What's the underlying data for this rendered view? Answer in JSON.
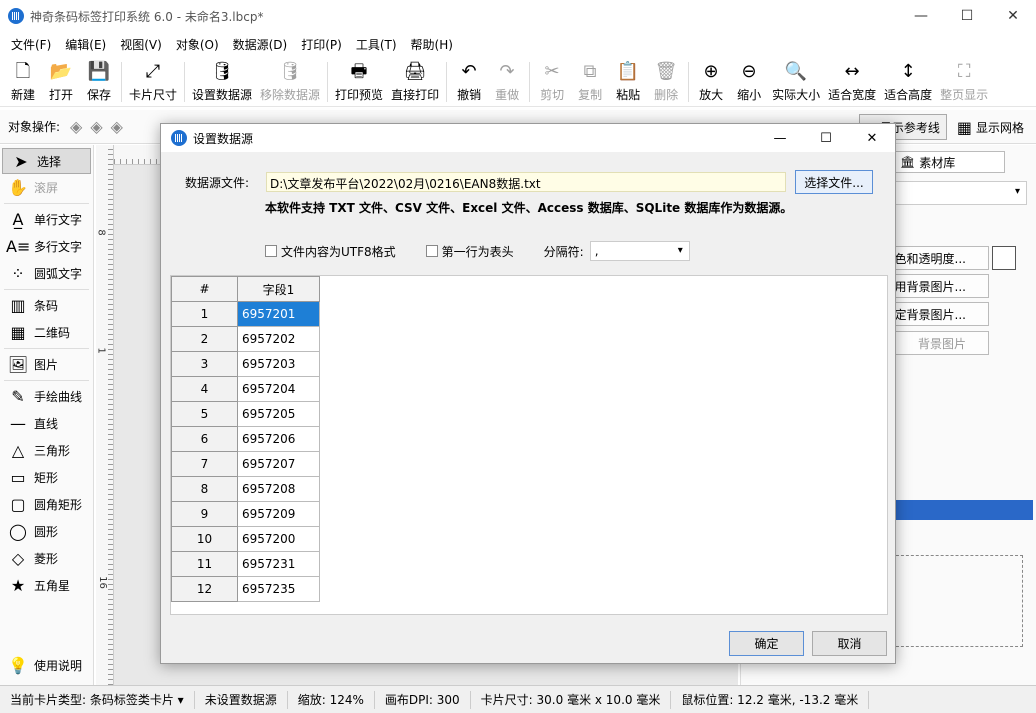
{
  "window": {
    "title": "神奇条码标签打印系统 6.0 - 未命名3.lbcp*",
    "minimize": "—",
    "maximize": "☐",
    "close": "✕"
  },
  "menu": [
    "文件(F)",
    "编辑(E)",
    "视图(V)",
    "对象(O)",
    "数据源(D)",
    "打印(P)",
    "工具(T)",
    "帮助(H)"
  ],
  "toolbar": [
    {
      "label": "新建",
      "icon": "new-icon",
      "glyph": "🗋",
      "enabled": true
    },
    {
      "label": "打开",
      "icon": "open-icon",
      "glyph": "📂",
      "enabled": true
    },
    {
      "label": "保存",
      "icon": "save-icon",
      "glyph": "💾",
      "enabled": true
    },
    {
      "label": "卡片尺寸",
      "icon": "card-size-icon",
      "glyph": "⤢",
      "enabled": true
    },
    {
      "label": "设置数据源",
      "icon": "set-datasource-icon",
      "glyph": "🛢",
      "enabled": true
    },
    {
      "label": "移除数据源",
      "icon": "remove-datasource-icon",
      "glyph": "🛢",
      "enabled": false
    },
    {
      "label": "打印预览",
      "icon": "print-preview-icon",
      "glyph": "🖶",
      "enabled": true
    },
    {
      "label": "直接打印",
      "icon": "print-icon",
      "glyph": "🖨",
      "enabled": true
    },
    {
      "label": "撤销",
      "icon": "undo-icon",
      "glyph": "↶",
      "enabled": true
    },
    {
      "label": "重做",
      "icon": "redo-icon",
      "glyph": "↷",
      "enabled": false
    },
    {
      "label": "剪切",
      "icon": "cut-icon",
      "glyph": "✂",
      "enabled": false
    },
    {
      "label": "复制",
      "icon": "copy-icon",
      "glyph": "⧉",
      "enabled": false
    },
    {
      "label": "粘贴",
      "icon": "paste-icon",
      "glyph": "📋",
      "enabled": true
    },
    {
      "label": "删除",
      "icon": "delete-icon",
      "glyph": "🗑",
      "enabled": false
    },
    {
      "label": "放大",
      "icon": "zoom-in-icon",
      "glyph": "⊕",
      "enabled": true
    },
    {
      "label": "缩小",
      "icon": "zoom-out-icon",
      "glyph": "⊖",
      "enabled": true
    },
    {
      "label": "实际大小",
      "icon": "actual-size-icon",
      "glyph": "🔍",
      "enabled": true
    },
    {
      "label": "适合宽度",
      "icon": "fit-width-icon",
      "glyph": "↔",
      "enabled": true
    },
    {
      "label": "适合高度",
      "icon": "fit-height-icon",
      "glyph": "↕",
      "enabled": true
    },
    {
      "label": "整页显示",
      "icon": "full-page-icon",
      "glyph": "⛶",
      "enabled": false
    }
  ],
  "objbar": {
    "label": "对象操作:",
    "guide_label": "显示参考线",
    "grid_label": "显示网格"
  },
  "tools": [
    {
      "label": "选择",
      "glyph": "➤",
      "icon": "pointer-icon",
      "selected": true,
      "enabled": true
    },
    {
      "label": "滚屏",
      "glyph": "✋",
      "icon": "hand-icon",
      "selected": false,
      "enabled": false
    },
    {
      "label": "单行文字",
      "glyph": "A̲",
      "icon": "single-text-icon",
      "selected": false,
      "enabled": true
    },
    {
      "label": "多行文字",
      "glyph": "A≡",
      "icon": "multi-text-icon",
      "selected": false,
      "enabled": true
    },
    {
      "label": "圆弧文字",
      "glyph": "⁘",
      "icon": "arc-text-icon",
      "selected": false,
      "enabled": true
    },
    {
      "label": "条码",
      "glyph": "▥",
      "icon": "barcode-icon",
      "selected": false,
      "enabled": true
    },
    {
      "label": "二维码",
      "glyph": "▦",
      "icon": "qrcode-icon",
      "selected": false,
      "enabled": true
    },
    {
      "label": "图片",
      "glyph": "🖼",
      "icon": "image-icon",
      "selected": false,
      "enabled": true
    },
    {
      "label": "手绘曲线",
      "glyph": "✎",
      "icon": "freehand-icon",
      "selected": false,
      "enabled": true
    },
    {
      "label": "直线",
      "glyph": "—",
      "icon": "line-icon",
      "selected": false,
      "enabled": true
    },
    {
      "label": "三角形",
      "glyph": "△",
      "icon": "triangle-icon",
      "selected": false,
      "enabled": true
    },
    {
      "label": "矩形",
      "glyph": "▭",
      "icon": "rectangle-icon",
      "selected": false,
      "enabled": true
    },
    {
      "label": "圆角矩形",
      "glyph": "▢",
      "icon": "rounded-rect-icon",
      "selected": false,
      "enabled": true
    },
    {
      "label": "圆形",
      "glyph": "◯",
      "icon": "circle-icon",
      "selected": false,
      "enabled": true
    },
    {
      "label": "菱形",
      "glyph": "◇",
      "icon": "diamond-icon",
      "selected": false,
      "enabled": true
    },
    {
      "label": "五角星",
      "glyph": "★",
      "icon": "star-icon",
      "selected": false,
      "enabled": true
    }
  ],
  "help": {
    "label": "使用说明",
    "glyph": "💡"
  },
  "ruler": {
    "marks": [
      "8",
      "1",
      "16"
    ]
  },
  "rightpanel": {
    "tab_label": "素材库",
    "btn_color": "色和透明度...",
    "btn_bg1": "用背景图片...",
    "btn_bg2": "定背景图片...",
    "btn_bg3": "背景图片"
  },
  "status": [
    "当前卡片类型: 条码标签类卡片 ▾",
    "未设置数据源",
    "缩放: 124%",
    "画布DPI: 300",
    "卡片尺寸: 30.0 毫米 x 10.0 毫米",
    "鼠标位置: 12.2 毫米, -13.2 毫米"
  ],
  "dialog": {
    "title": "设置数据源",
    "file_label": "数据源文件:",
    "file_path": "D:\\文章发布平台\\2022\\02月\\0216\\EAN8数据.txt",
    "choose_btn": "选择文件...",
    "support_text": "本软件支持 TXT 文件、CSV 文件、Excel 文件、Access 数据库、SQLite 数据库作为数据源。",
    "utf8_label": "文件内容为UTF8格式",
    "header_label": "第一行为表头",
    "sep_label": "分隔符:",
    "sep_value": ",",
    "ok": "确定",
    "cancel": "取消",
    "grid": {
      "headers": [
        "#",
        "字段1"
      ],
      "rows": [
        [
          "1",
          "6957201"
        ],
        [
          "2",
          "6957202"
        ],
        [
          "3",
          "6957203"
        ],
        [
          "4",
          "6957204"
        ],
        [
          "5",
          "6957205"
        ],
        [
          "6",
          "6957206"
        ],
        [
          "7",
          "6957207"
        ],
        [
          "8",
          "6957208"
        ],
        [
          "9",
          "6957209"
        ],
        [
          "10",
          "6957200"
        ],
        [
          "11",
          "6957231"
        ],
        [
          "12",
          "6957235"
        ]
      ]
    }
  }
}
